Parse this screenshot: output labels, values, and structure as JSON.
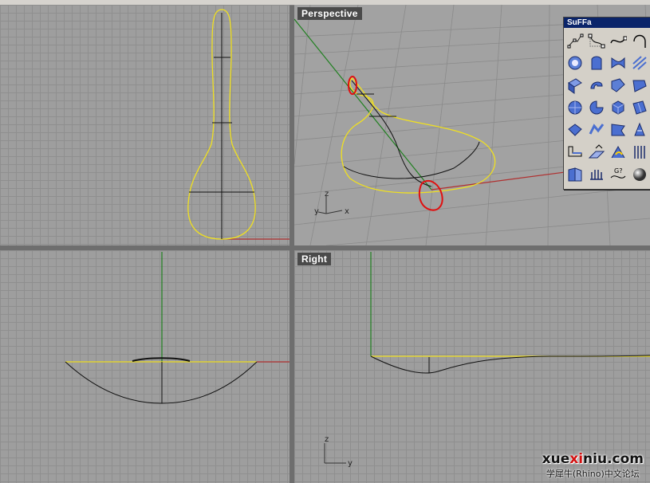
{
  "viewports": {
    "top": {
      "label": ""
    },
    "perspective": {
      "label": "Perspective",
      "axis_labels": {
        "z": "z",
        "y": "y",
        "x": "x"
      }
    },
    "front": {
      "label": ""
    },
    "right": {
      "label": "Right",
      "axis_labels": {
        "z": "z",
        "y": "y"
      }
    }
  },
  "toolbar": {
    "title": "SuFFa",
    "tools": [
      "curve-points-icon",
      "curve-control-icon",
      "curve-interpolate-icon",
      "curve-arc-icon",
      "sphere-surface-icon",
      "box-surface-icon",
      "twist-surface-icon",
      "wire-surface-icon",
      "extrude-surface-icon",
      "revolve-surface-icon",
      "sweep-surface-icon",
      "loft-surface-icon",
      "sphere-icon",
      "pie-icon",
      "cube-icon",
      "patch-icon",
      "fold-icon",
      "ribbon-icon",
      "flag-icon",
      "network-icon",
      "plane-edge-icon",
      "offset-icon",
      "blend-icon",
      "grid-icon",
      "book-icon",
      "split-icon",
      "g2-match-icon",
      "render-sphere-icon"
    ],
    "extra_text": {
      "g2": "G?"
    }
  },
  "watermark": {
    "domain_prefix": "xue",
    "domain_highlight": "xi",
    "domain_suffix": "niu.com",
    "subtitle": "学犀牛(Rhino)中文论坛"
  },
  "colors": {
    "curve": "#f0e020",
    "x_axis": "#b03030",
    "y_axis": "#208020",
    "annotation": "#e01010"
  }
}
